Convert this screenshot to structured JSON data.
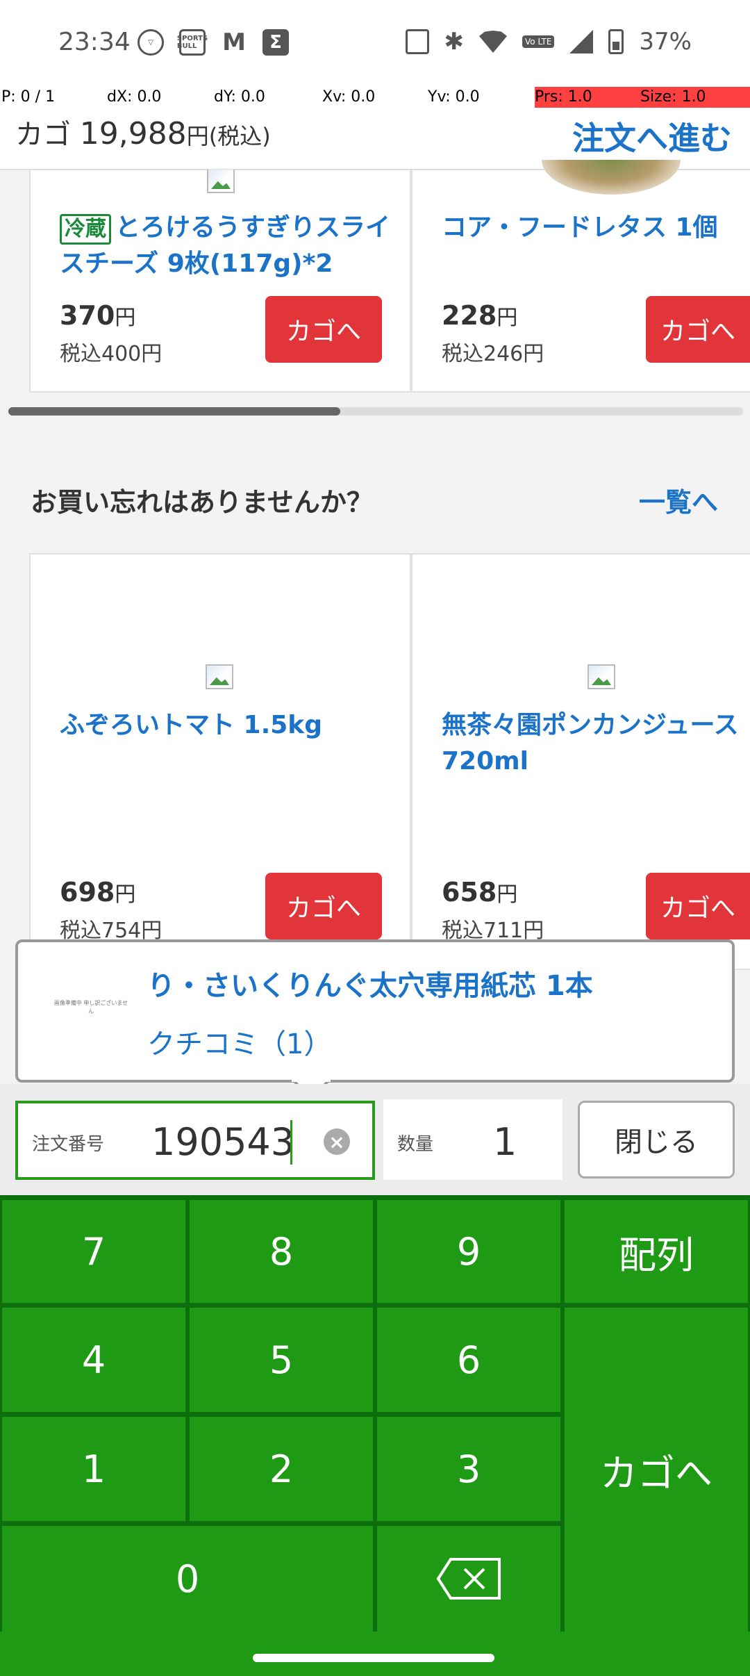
{
  "status_bar": {
    "time": "23:34",
    "left_icons": [
      "shield-icon",
      "sports-bull-icon",
      "gmail-icon",
      "sigma-icon"
    ],
    "sports_bull_text": "SPORTS BULL",
    "sigma_text": "Σ",
    "volte_text": "Vo LTE",
    "battery_percent": "37%"
  },
  "debug": {
    "p": "P: 0 / 1",
    "dx": "dX: 0.0",
    "dy": "dY: 0.0",
    "xv": "Xv: 0.0",
    "yv": "Yv: 0.0",
    "prs": "Prs: 1.0",
    "size": "Size: 1.0"
  },
  "cart": {
    "label": "カゴ",
    "amount": "19,988",
    "yen": "円",
    "tax": "(税込)",
    "checkout": "注文へ進む"
  },
  "recommended": [
    {
      "tag": "冷蔵",
      "title": "とろけるうすぎりスライスチーズ 9枚(117g)*2",
      "price": "370",
      "yen": "円",
      "price_tax": "税込400円",
      "button": "カゴへ"
    },
    {
      "title": "コア・フードレタス 1個",
      "price": "228",
      "yen": "円",
      "price_tax": "税込246円",
      "button": "カゴへ"
    }
  ],
  "forgot_section": {
    "title": "お買い忘れはありませんか？",
    "link": "一覧へ",
    "items": [
      {
        "title": "ふぞろいトマト 1.5kg",
        "price": "698",
        "yen": "円",
        "price_tax": "税込754円",
        "button": "カゴへ"
      },
      {
        "title": "無茶々園ポンカンジュース 720ml",
        "price": "658",
        "yen": "円",
        "price_tax": "税込711円",
        "button": "カゴへ"
      }
    ]
  },
  "popup": {
    "thumb_text": "画像準備中 申し訳ございません",
    "title": "り・さいくりんぐ太穴専用紙芯 1本",
    "review": "クチコミ（1）"
  },
  "input": {
    "order_label": "注文番号",
    "order_value": "190543",
    "qty_label": "数量",
    "qty_value": "1",
    "close": "閉じる"
  },
  "keypad": {
    "k7": "7",
    "k8": "8",
    "k9": "9",
    "arrange": "配列",
    "k4": "4",
    "k5": "5",
    "k6": "6",
    "k1": "1",
    "k2": "2",
    "k3": "3",
    "add_cart": "カゴへ",
    "k0": "0"
  },
  "colors": {
    "accent_blue": "#1a73c8",
    "button_red": "#e2353a",
    "keypad_green": "#1e9a14",
    "field_border_green": "#2a9a1c"
  }
}
